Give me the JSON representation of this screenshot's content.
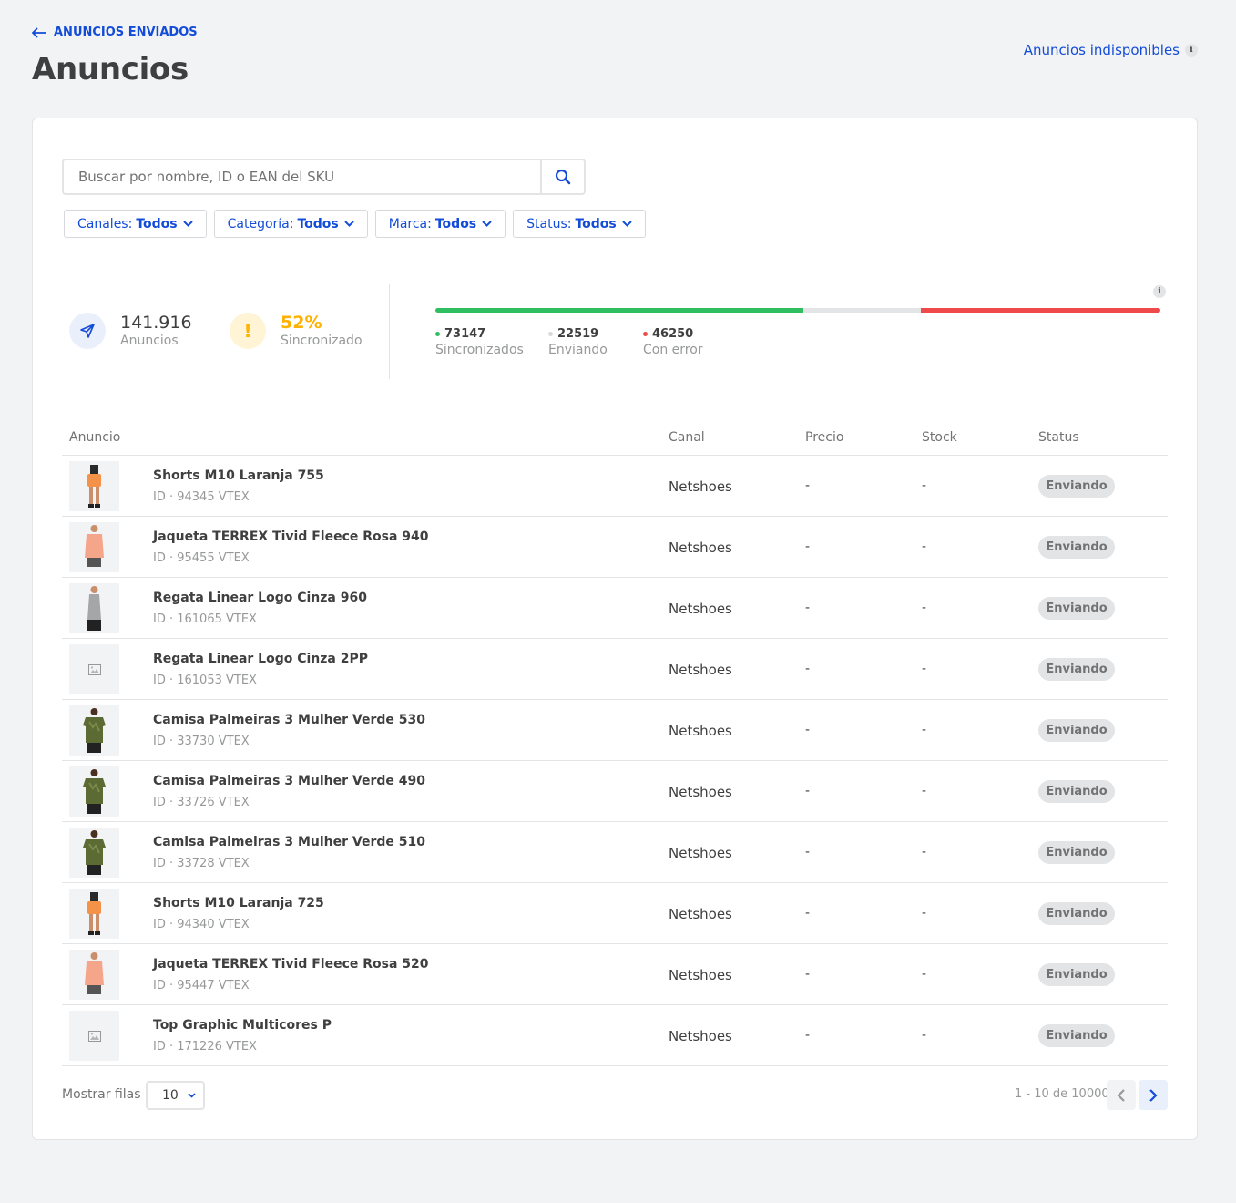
{
  "header": {
    "back_label": "ANUNCIOS ENVIADOS",
    "title": "Anuncios",
    "unavailable_link": "Anuncios indisponibles",
    "info_glyph": "i"
  },
  "search": {
    "placeholder": "Buscar por nombre, ID o EAN del SKU"
  },
  "filters": [
    {
      "label": "Canales:",
      "value": "Todos"
    },
    {
      "label": "Categoría:",
      "value": "Todos"
    },
    {
      "label": "Marca:",
      "value": "Todos"
    },
    {
      "label": "Status:",
      "value": "Todos"
    }
  ],
  "stats": {
    "total_value": "141.916",
    "total_label": "Anuncios",
    "sync_value": "52%",
    "sync_label": "Sincronizado",
    "warning_glyph": "!"
  },
  "progress": {
    "synced_value": "73147",
    "synced_label": "Sincronizados",
    "sending_value": "22519",
    "sending_label": "Enviando",
    "error_value": "46250",
    "error_label": "Con error",
    "synced_fraction": 0.508,
    "sending_fraction": 0.162,
    "error_fraction": 0.33,
    "colors": {
      "synced": "#2fbf60",
      "sending": "#e3e4e6",
      "error": "#f0494a"
    }
  },
  "table": {
    "headers": {
      "anuncio": "Anuncio",
      "canal": "Canal",
      "precio": "Precio",
      "stock": "Stock",
      "status": "Status"
    },
    "rows": [
      {
        "name": "Shorts M10 Laranja 755",
        "id": "ID · 94345 VTEX",
        "canal": "Netshoes",
        "precio": "-",
        "stock": "-",
        "status": "Enviando",
        "thumb": "shorts"
      },
      {
        "name": "Jaqueta TERREX Tivid Fleece Rosa 940",
        "id": "ID · 95455 VTEX",
        "canal": "Netshoes",
        "precio": "-",
        "stock": "-",
        "status": "Enviando",
        "thumb": "jacket"
      },
      {
        "name": "Regata Linear Logo Cinza 960",
        "id": "ID · 161065 VTEX",
        "canal": "Netshoes",
        "precio": "-",
        "stock": "-",
        "status": "Enviando",
        "thumb": "tank"
      },
      {
        "name": "Regata Linear Logo Cinza 2PP",
        "id": "ID · 161053 VTEX",
        "canal": "Netshoes",
        "precio": "-",
        "stock": "-",
        "status": "Enviando",
        "thumb": "placeholder"
      },
      {
        "name": "Camisa Palmeiras 3 Mulher Verde 530",
        "id": "ID · 33730 VTEX",
        "canal": "Netshoes",
        "precio": "-",
        "stock": "-",
        "status": "Enviando",
        "thumb": "jersey"
      },
      {
        "name": "Camisa Palmeiras 3 Mulher Verde 490",
        "id": "ID · 33726 VTEX",
        "canal": "Netshoes",
        "precio": "-",
        "stock": "-",
        "status": "Enviando",
        "thumb": "jersey"
      },
      {
        "name": "Camisa Palmeiras 3 Mulher Verde 510",
        "id": "ID · 33728 VTEX",
        "canal": "Netshoes",
        "precio": "-",
        "stock": "-",
        "status": "Enviando",
        "thumb": "jersey"
      },
      {
        "name": "Shorts M10 Laranja 725",
        "id": "ID · 94340 VTEX",
        "canal": "Netshoes",
        "precio": "-",
        "stock": "-",
        "status": "Enviando",
        "thumb": "shorts"
      },
      {
        "name": "Jaqueta TERREX Tivid Fleece Rosa 520",
        "id": "ID · 95447 VTEX",
        "canal": "Netshoes",
        "precio": "-",
        "stock": "-",
        "status": "Enviando",
        "thumb": "jacket"
      },
      {
        "name": "Top Graphic Multicores P",
        "id": "ID · 171226 VTEX",
        "canal": "Netshoes",
        "precio": "-",
        "stock": "-",
        "status": "Enviando",
        "thumb": "placeholder"
      }
    ]
  },
  "footer": {
    "rows_label": "Mostrar filas",
    "rows_value": "10",
    "page_info": "1 - 10 de 10000"
  },
  "colors": {
    "accent": "#134cd8",
    "warning": "#ffb100",
    "badge_bg": "#e3e4e6"
  }
}
